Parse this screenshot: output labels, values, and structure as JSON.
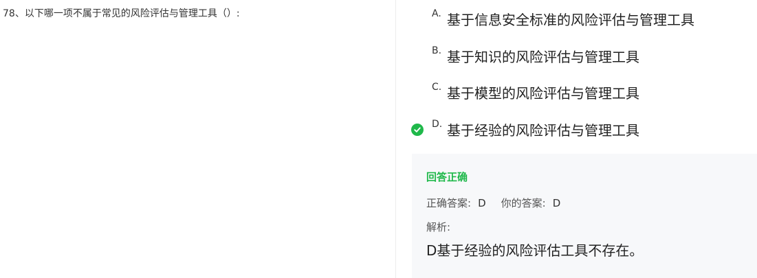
{
  "question": {
    "text": "78、以下哪一项不属于常见的风险评估与管理工具（）:"
  },
  "options": [
    {
      "letter": "A.",
      "text": "基于信息安全标准的风险评估与管理工具",
      "selected": false
    },
    {
      "letter": "B.",
      "text": "基于知识的风险评估与管理工具",
      "selected": false
    },
    {
      "letter": "C.",
      "text": "基于模型的风险评估与管理工具",
      "selected": false
    },
    {
      "letter": "D.",
      "text": "基于经验的风险评估与管理工具",
      "selected": true
    }
  ],
  "result": {
    "status": "回答正确",
    "correct_label": "正确答案:",
    "correct_value": "D",
    "your_label": "你的答案:",
    "your_value": "D",
    "analysis_label": "解析:",
    "analysis_text": "D基于经验的风险评估工具不存在。"
  },
  "colors": {
    "success": "#1fb84a",
    "panel_bg": "#f7f8fa",
    "divider": "#ececec"
  },
  "icons": {
    "selected_option": "check-circle-icon"
  }
}
